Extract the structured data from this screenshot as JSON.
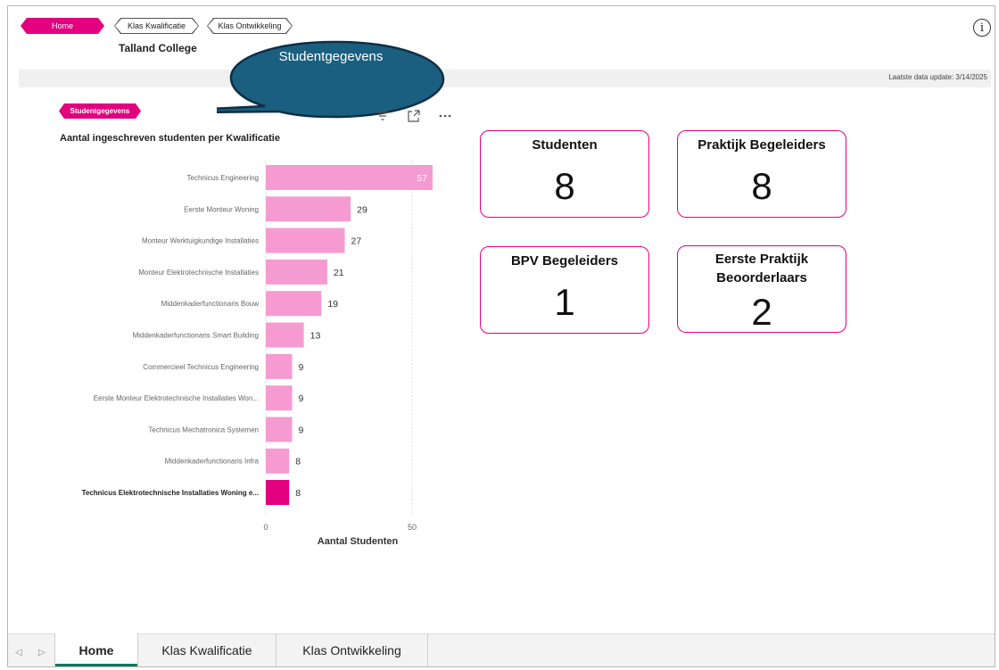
{
  "nav": {
    "home": "Home",
    "klas_kwalificatie": "Klas Kwalificatie",
    "klas_ontwikkeling": "Klas Ontwikkeling"
  },
  "header": {
    "college": "Talland College",
    "update": "Laatste data update: 3/14/2025"
  },
  "callout": {
    "text": "Studentgegevens"
  },
  "tag": "Studentgegevens",
  "chart_data": {
    "type": "bar",
    "orientation": "horizontal",
    "title": "Aantal ingeschreven studenten per Kwalificatie",
    "xlabel": "Aantal Studenten",
    "xlim": [
      0,
      57
    ],
    "xticks": [
      0,
      50
    ],
    "categories": [
      "Technicus Engineering",
      "Eerste Monteur Woning",
      "Monteur Werktuigkundige Installaties",
      "Monteur Elektrotechnische Installaties",
      "Middenkaderfunctionaris Bouw",
      "Middenkaderfunctionaris Smart Building",
      "Commercieel Technicus Engineering",
      "Eerste Monteur Elektrotechnische Installaties Won...",
      "Technicus Mechatronica Systemen",
      "Middenkaderfunctionaris Infra",
      "Technicus Elektrotechnische Installaties Woning e..."
    ],
    "values": [
      57,
      29,
      27,
      21,
      19,
      13,
      9,
      9,
      9,
      8,
      8
    ],
    "highlight_index": 10,
    "colors": {
      "bar": "#f59bd1",
      "highlight": "#e3007f"
    }
  },
  "cards": [
    {
      "title": "Studenten",
      "value": "8"
    },
    {
      "title": "Praktijk Begeleiders",
      "value": "8"
    },
    {
      "title": "BPV Begeleiders",
      "value": "1"
    },
    {
      "title": "Eerste Praktijk Beoorderlaars",
      "value": "2"
    }
  ],
  "tabs": [
    "Home",
    "Klas Kwalificatie",
    "Klas Ontwikkeling"
  ],
  "icons": [
    "info-icon",
    "filter-icon",
    "focus-mode-icon",
    "more-options-icon",
    "prev-page-icon",
    "next-page-icon"
  ],
  "colors": {
    "accent": "#e3007f",
    "callout": "#1b5f80",
    "tab_underline": "#117865"
  }
}
